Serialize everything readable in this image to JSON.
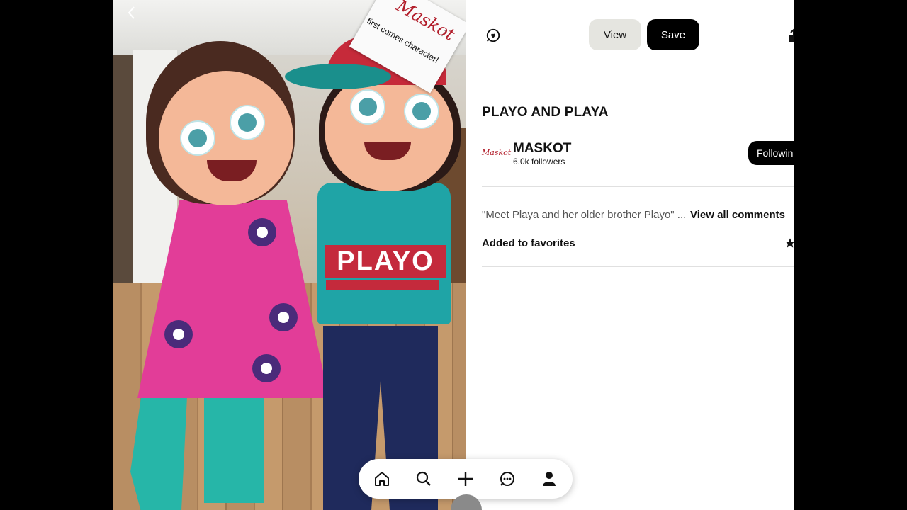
{
  "photo": {
    "brand_logo": "Maskot",
    "brand_tagline": "first comes character!",
    "shirt_text": "PLAYO"
  },
  "header": {
    "view_label": "View",
    "save_label": "Save"
  },
  "pin": {
    "title": "PLAYO AND PLAYA",
    "creator_name": "MASKOT",
    "followers": "6.0k followers",
    "follow_label": "Following",
    "comment_preview": "\"Meet Playa and her older brother Playo\" ...",
    "view_comments_label": "View all comments",
    "favorites_label": "Added to favorites"
  },
  "icons": {
    "back": "chevron-left-icon",
    "reaction": "heart-chat-icon",
    "share": "share-icon",
    "favorite": "star-icon",
    "nav": [
      "home-icon",
      "search-icon",
      "plus-icon",
      "messages-icon",
      "profile-icon"
    ]
  }
}
